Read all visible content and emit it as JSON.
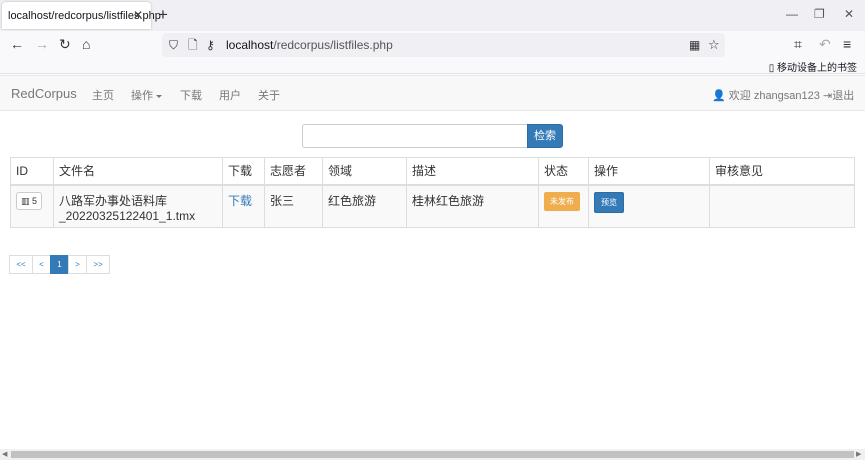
{
  "browser": {
    "tab_title": "localhost/redcorpus/listfiles.php",
    "url_host": "localhost",
    "url_path": "/redcorpus/listfiles.php",
    "mobile_bookmarks": "移动设备上的书签"
  },
  "site": {
    "brand": "RedCorpus",
    "nav": [
      "主页",
      "操作",
      "下载",
      "用户",
      "关于"
    ],
    "welcome": "欢迎 zhangsan123",
    "logout": "退出"
  },
  "search": {
    "button": "检索",
    "value": ""
  },
  "table": {
    "headers": [
      "ID",
      "文件名",
      "下载",
      "志愿者",
      "领域",
      "描述",
      "状态",
      "操作",
      "审核意见"
    ],
    "rows": [
      {
        "id": "5",
        "filename_line1": "八路军办事处语料库",
        "filename_line2": "_20220325122401_1.tmx",
        "download": "下载",
        "volunteer": "张三",
        "domain": "红色旅游",
        "description": "桂林红色旅游",
        "status": "未发布",
        "action": "预览",
        "review": ""
      }
    ]
  },
  "pagination": [
    "<<",
    "<",
    "1",
    ">",
    ">>"
  ],
  "colors": {
    "primary": "#337ab7",
    "warning": "#f0ad4e"
  }
}
